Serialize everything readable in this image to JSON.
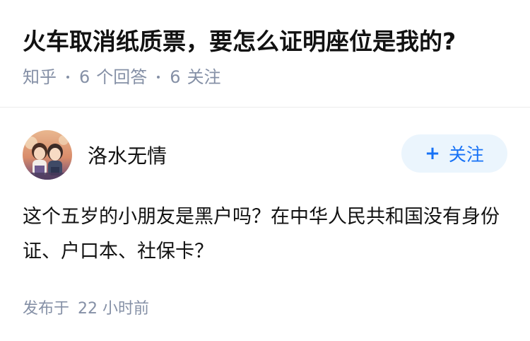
{
  "question": {
    "title": "火车取消纸质票，要怎么证明座位是我的?",
    "source": "知乎",
    "answers_count": "6",
    "answers_label": "个回答",
    "followers_count": "6",
    "followers_label": "关注"
  },
  "answer": {
    "author_name": "洛水无情",
    "follow_button_label": "关注",
    "content": "这个五岁的小朋友是黑户吗？在中华人民共和国没有身份证、户口本、社保卡？",
    "published_label": "发布于",
    "published_time": "22 小时前"
  },
  "colors": {
    "accent": "#1772f6",
    "follow_bg": "#ebf5fd",
    "meta_text": "#8590a6",
    "text": "#121212"
  },
  "icons": {
    "follow": "plus-icon"
  }
}
